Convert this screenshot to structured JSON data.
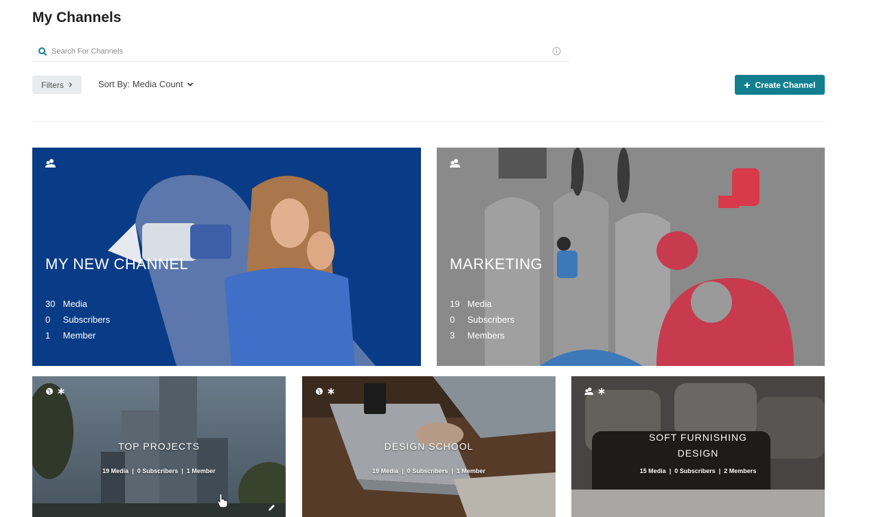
{
  "page": {
    "title": "My Channels"
  },
  "search": {
    "placeholder": "Search For Channels"
  },
  "toolbar": {
    "filters_label": "Filters",
    "sort_label": "Sort By: Media Count",
    "create_label": "Create Channel"
  },
  "colors": {
    "accent": "#127f8f",
    "card1_bg": "#0a3b86",
    "card2_bg": "#8a8a8a"
  },
  "channels": [
    {
      "name": "MY NEW CHANNEL",
      "media": "30",
      "media_label": "Media",
      "subscribers": "0",
      "subscribers_label": "Subscribers",
      "members": "1",
      "members_label": "Member",
      "icon": "group-icon"
    },
    {
      "name": "MARKETING",
      "media": "19",
      "media_label": "Media",
      "subscribers": "0",
      "subscribers_label": "Subscribers",
      "members": "3",
      "members_label": "Members",
      "icon": "group-icon"
    },
    {
      "name": "TOP PROJECTS",
      "stats_media": "19 Media",
      "stats_subscribers": "0 Subscribers",
      "stats_members": "1 Member",
      "icon": "globe-icon"
    },
    {
      "name": "DESIGN SCHOOL",
      "stats_media": "19 Media",
      "stats_subscribers": "0 Subscribers",
      "stats_members": "1 Member",
      "icon": "globe-icon"
    },
    {
      "name_line1": "SOFT FURNISHING",
      "name_line2": "DESIGN",
      "stats_media": "15 Media",
      "stats_subscribers": "0 Subscribers",
      "stats_members": "2 Members",
      "icon": "group-icon"
    }
  ]
}
